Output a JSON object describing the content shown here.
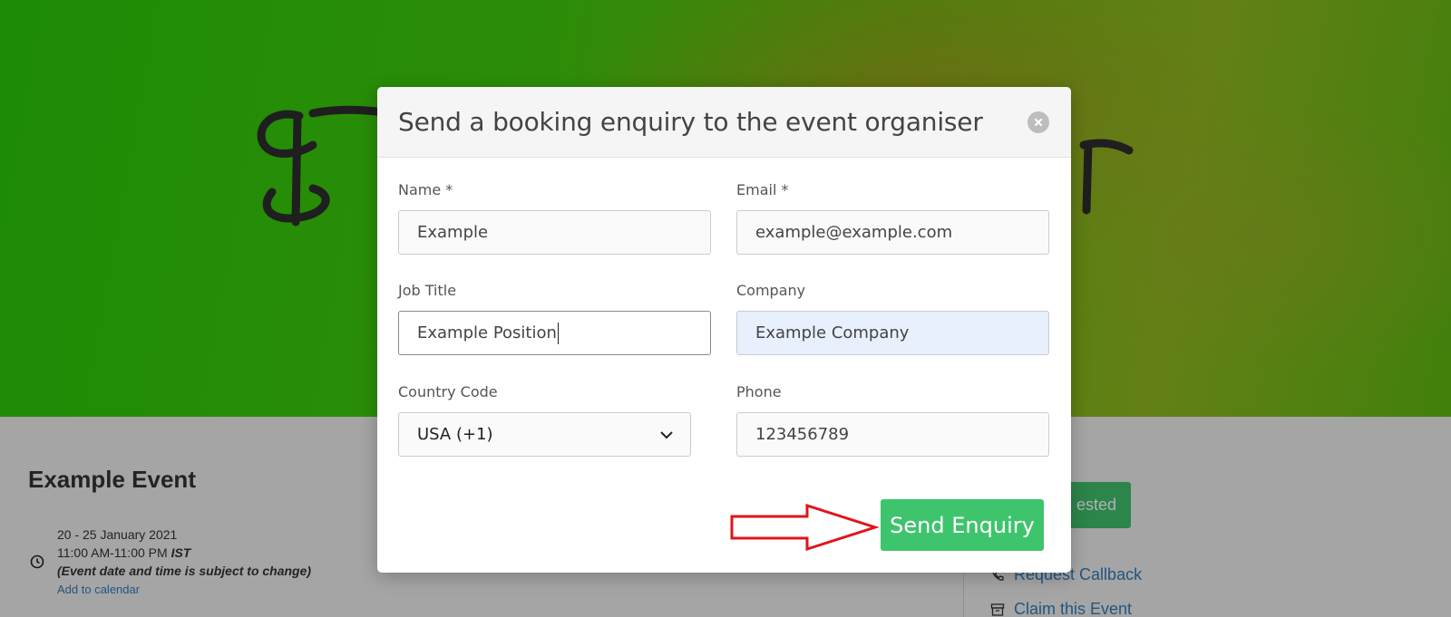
{
  "background_page": {
    "event_title": "Example Event",
    "date_range": "20 - 25 January 2021",
    "time_range": "11:00 AM-11:00 PM",
    "timezone": "IST",
    "disclaimer": "(Event date and time is subject to change)",
    "add_to_calendar": "Add to calendar",
    "interested_button_partial": "ested",
    "side_links": [
      {
        "label": "Request Callback",
        "icon": "phone-icon"
      },
      {
        "label": "Claim this Event",
        "icon": "archive-icon"
      }
    ]
  },
  "modal": {
    "title": "Send a booking enquiry to the event organiser",
    "fields": {
      "name": {
        "label": "Name *",
        "value": "Example"
      },
      "email": {
        "label": "Email *",
        "value": "example@example.com"
      },
      "job_title": {
        "label": "Job Title",
        "value": "Example Position"
      },
      "company": {
        "label": "Company",
        "value": "Example Company"
      },
      "country_code": {
        "label": "Country Code",
        "value": "USA (+1)"
      },
      "phone": {
        "label": "Phone",
        "value": "123456789"
      }
    },
    "submit_label": "Send Enquiry"
  },
  "colors": {
    "submit": "#3fc46e",
    "annotation_arrow": "#e0151b",
    "link": "#337ab7"
  }
}
